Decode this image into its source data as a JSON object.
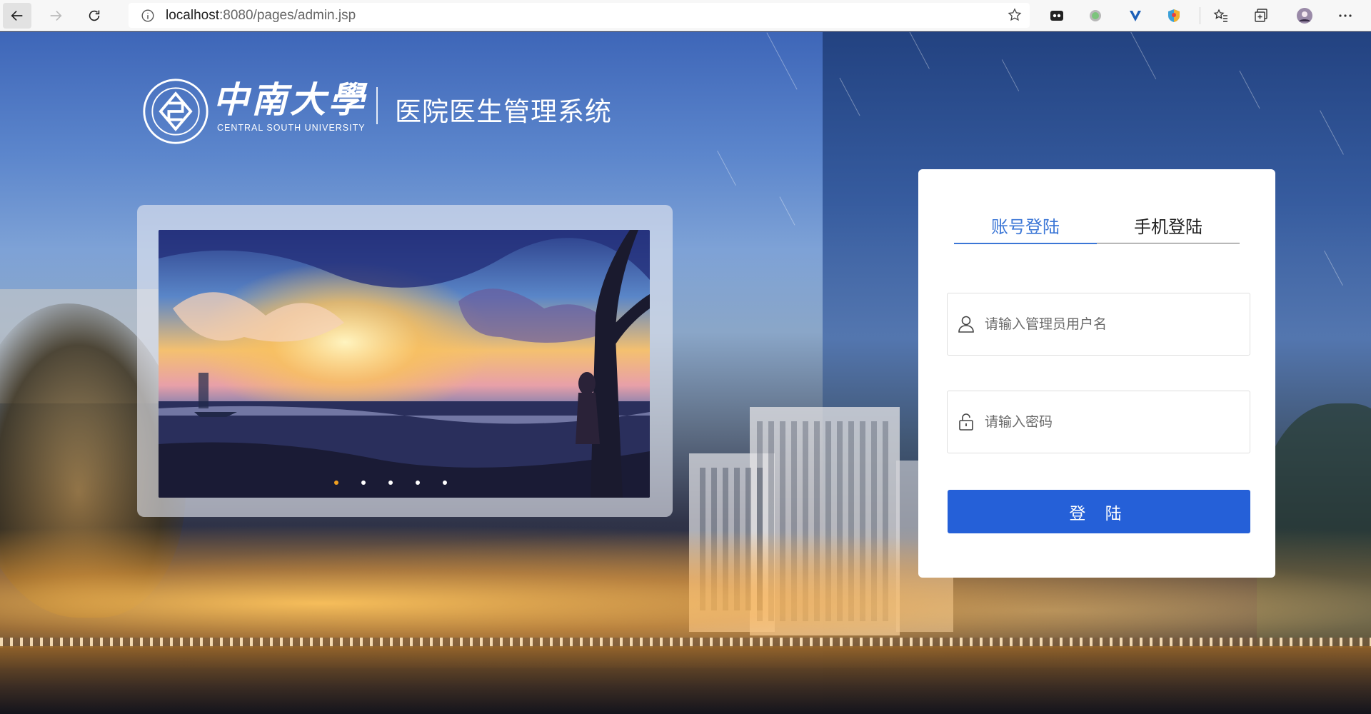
{
  "browser": {
    "url_host": "localhost",
    "url_path": ":8080/pages/admin.jsp",
    "icons": {
      "back": "back-arrow-icon",
      "forward": "forward-arrow-icon",
      "reload": "reload-icon",
      "info": "site-info-icon",
      "favorite": "star-icon",
      "extensions": [
        "extension-icon-1",
        "extension-icon-2",
        "extension-icon-3",
        "extension-icon-4"
      ],
      "favorites_bar": "favorites-icon",
      "collections": "collections-icon",
      "profile": "profile-avatar",
      "menu": "more-menu-icon"
    }
  },
  "header": {
    "university_cn": "中南大學",
    "university_en": "CENTRAL SOUTH UNIVERSITY",
    "system_title": "医院医生管理系统"
  },
  "carousel": {
    "slide_count": 5,
    "active_index": 0,
    "active_color": "#f0a020"
  },
  "login": {
    "tabs": [
      {
        "label": "账号登陆",
        "active": true
      },
      {
        "label": "手机登陆",
        "active": false
      }
    ],
    "username_placeholder": "请输入管理员用户名",
    "password_placeholder": "请输入密码",
    "submit_label": "登 陆",
    "accent_color": "#2560d8",
    "tab_active_color": "#3b76d6"
  }
}
